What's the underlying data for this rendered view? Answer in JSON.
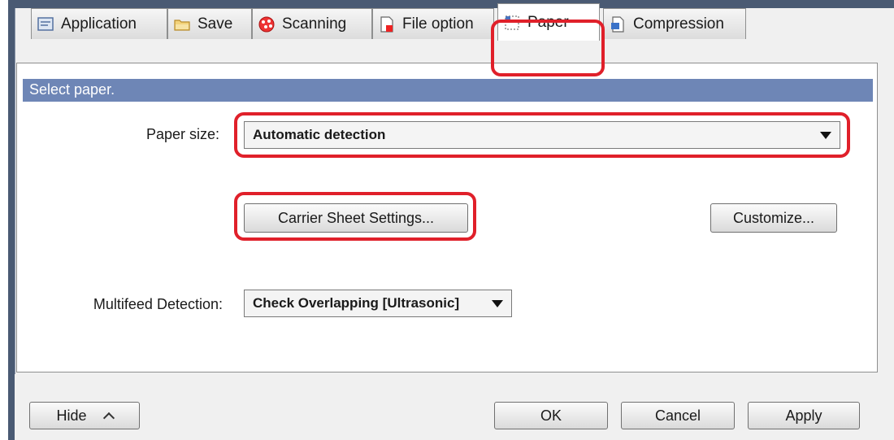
{
  "tabs": [
    {
      "label": "Application",
      "icon": "application-icon"
    },
    {
      "label": "Save",
      "icon": "folder-icon"
    },
    {
      "label": "Scanning",
      "icon": "scanning-icon"
    },
    {
      "label": "File option",
      "icon": "file-option-icon"
    },
    {
      "label": "Paper",
      "icon": "paper-icon",
      "active": true
    },
    {
      "label": "Compression",
      "icon": "compression-icon"
    }
  ],
  "panel": {
    "header": "Select paper."
  },
  "paper_size": {
    "label": "Paper size:",
    "value": "Automatic detection"
  },
  "carrier_button": "Carrier Sheet Settings...",
  "customize_button": "Customize...",
  "multifeed": {
    "label": "Multifeed Detection:",
    "value": "Check Overlapping [Ultrasonic]"
  },
  "footer": {
    "hide": "Hide",
    "ok": "OK",
    "cancel": "Cancel",
    "apply": "Apply"
  },
  "colors": {
    "header_bg": "#6e86b6",
    "highlight": "#e0202a"
  }
}
